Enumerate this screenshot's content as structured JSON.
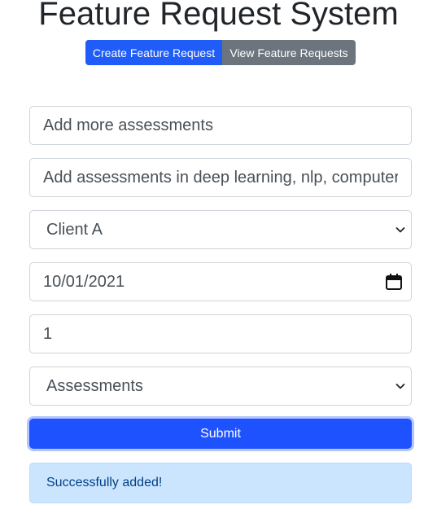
{
  "header": {
    "title": "Feature Request System"
  },
  "nav": {
    "create_label": "Create Feature Request",
    "view_label": "View Feature Requests"
  },
  "form": {
    "title_value": "Add more assessments",
    "description_value": "Add assessments in deep learning, nlp, computer vision",
    "client_selected": "Client A",
    "target_date_value": "10/01/2021",
    "priority_value": "1",
    "product_area_selected": "Assessments",
    "submit_label": "Submit"
  },
  "alert": {
    "message": "Successfully added!"
  },
  "icons": {
    "select_arrow": "chevron-down-icon",
    "date_picker": "calendar-icon"
  },
  "colors": {
    "primary": "#1f5cf8",
    "secondary": "#6c757d",
    "alert_bg": "#cce5ff",
    "alert_text": "#004085"
  }
}
